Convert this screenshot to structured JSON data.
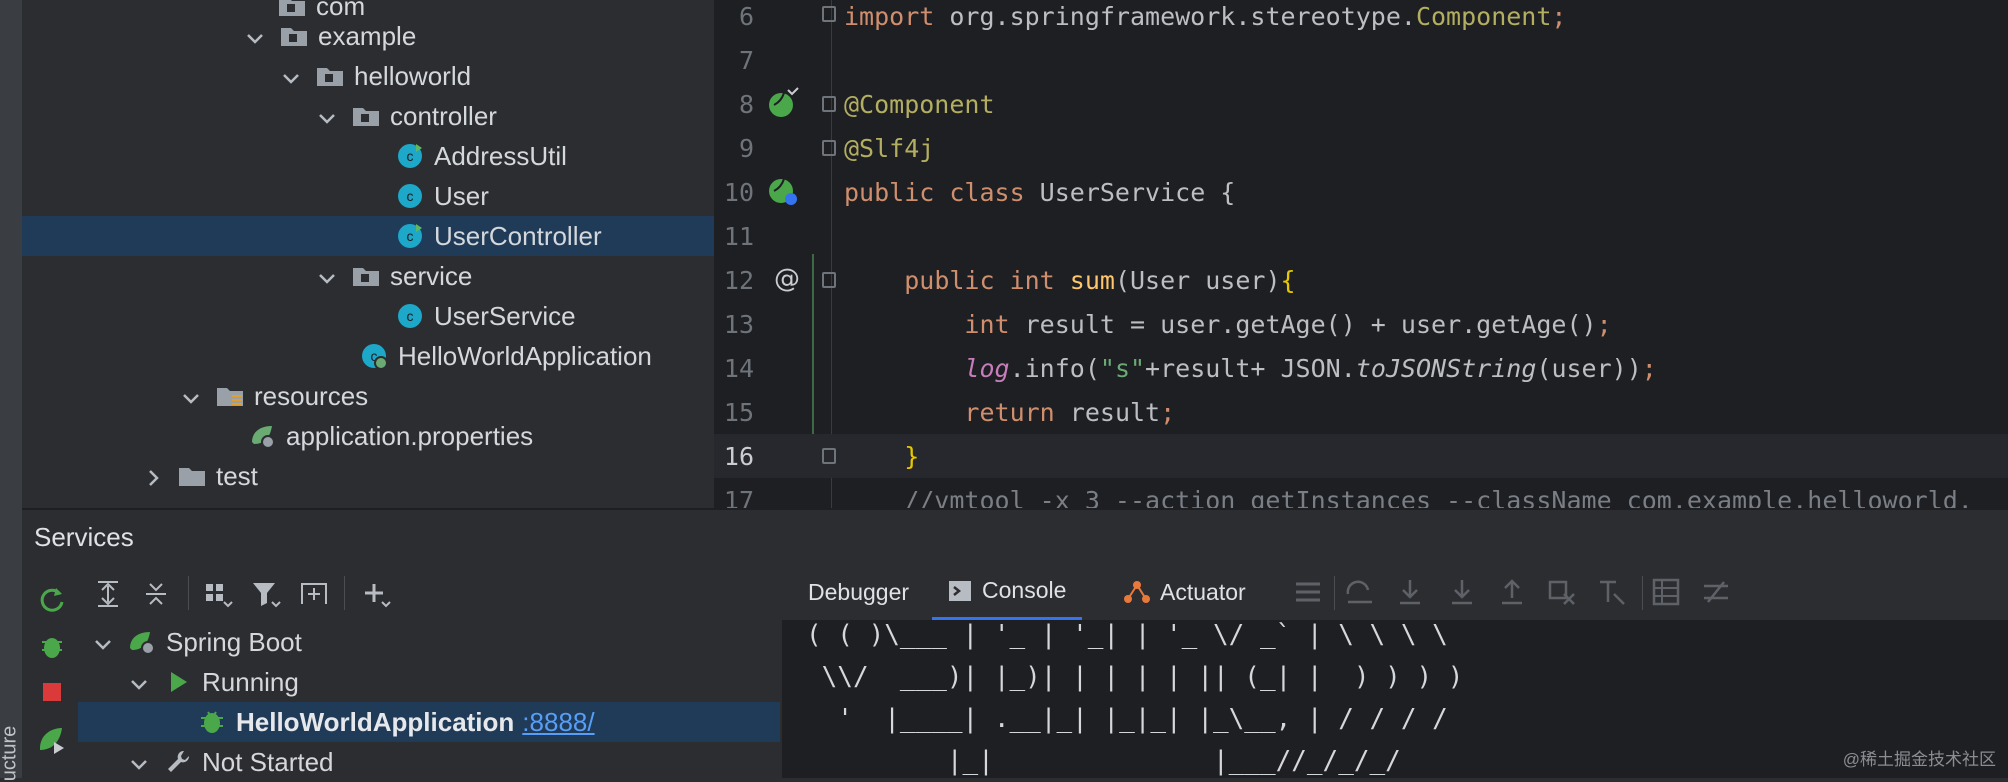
{
  "left_strip": {
    "label": "ucture"
  },
  "project_tree": {
    "rows": [
      {
        "label": "com",
        "indent": 1,
        "kind": "folder"
      },
      {
        "label": "example",
        "indent": 1,
        "kind": "folder"
      },
      {
        "label": "helloworld",
        "indent": 2,
        "kind": "folder"
      },
      {
        "label": "controller",
        "indent": 3,
        "kind": "folder"
      },
      {
        "label": "AddressUtil",
        "indent": 4,
        "kind": "class"
      },
      {
        "label": "User",
        "indent": 4,
        "kind": "class"
      },
      {
        "label": "UserController",
        "indent": 4,
        "kind": "class",
        "selected": true
      },
      {
        "label": "service",
        "indent": 3,
        "kind": "folder"
      },
      {
        "label": "UserService",
        "indent": 4,
        "kind": "class"
      },
      {
        "label": "HelloWorldApplication",
        "indent": 3,
        "kind": "spring-class"
      },
      {
        "label": "resources",
        "indent": 1,
        "kind": "resources-folder"
      },
      {
        "label": "application.properties",
        "indent": 2,
        "kind": "properties"
      },
      {
        "label": "test",
        "indent": 1,
        "kind": "folder"
      }
    ]
  },
  "editor": {
    "lines": [
      {
        "n": "6",
        "text": "import org.springframework.stereotype.Component;"
      },
      {
        "n": "7",
        "text": ""
      },
      {
        "n": "8",
        "text": "@Component"
      },
      {
        "n": "9",
        "text": "@Slf4j"
      },
      {
        "n": "10",
        "text": "public class UserService {"
      },
      {
        "n": "11",
        "text": ""
      },
      {
        "n": "12",
        "text": "    public int sum(User user){"
      },
      {
        "n": "13",
        "text": "        int result = user.getAge() + user.getAge();"
      },
      {
        "n": "14",
        "text": "        log.info(\"s\"+result+ JSON.toJSONString(user));"
      },
      {
        "n": "15",
        "text": "        return result;"
      },
      {
        "n": "16",
        "text": "    }"
      },
      {
        "n": "17",
        "text": "    //vmtool -x 3 --action getInstances --className com.example.helloworld."
      }
    ]
  },
  "services": {
    "title": "Services",
    "tree": [
      {
        "label": "Spring Boot",
        "indent": 0
      },
      {
        "label": "Running",
        "indent": 1
      },
      {
        "label": "HelloWorldApplication",
        "port": ":8888/",
        "indent": 2,
        "selected": true
      },
      {
        "label": "Not Started",
        "indent": 1
      }
    ],
    "tabs": [
      {
        "label": "Debugger",
        "active": false
      },
      {
        "label": "Console",
        "active": true
      },
      {
        "label": "Actuator",
        "active": false
      }
    ],
    "console": [
      "( ( )\\___ | '_ | '_| | '_ \\/ _` | \\ \\ \\ \\",
      " \\\\/  ___)| |_)| | | | | || (_| |  ) ) ) )",
      "  '  |____| .__|_| |_|_| |_\\__, | / / / /",
      "         |_|              |___//_/_/_/"
    ]
  },
  "watermark": "@稀土掘金技术社区",
  "colors": {
    "selection": "#1f3b58",
    "accent": "#3574f0",
    "keyword": "#cf8e6d",
    "annotation": "#b3ae60",
    "function": "#56a8f5",
    "string": "#6aab73"
  }
}
